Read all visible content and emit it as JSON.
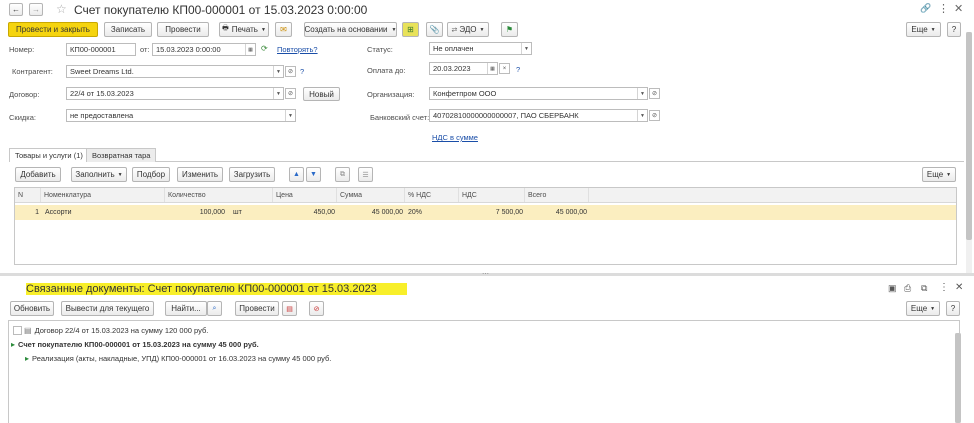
{
  "window": {
    "title": "Счет покупателю КП00-000001 от 15.03.2023 0:00:00"
  },
  "toolbar": {
    "post_close": "Провести и закрыть",
    "save": "Записать",
    "post": "Провести",
    "print": "Печать",
    "create_based": "Создать на основании",
    "edo": "ЭДО",
    "more": "Еще"
  },
  "form": {
    "number_label": "Номер:",
    "number_value": "КП00-000001",
    "from_label": "от:",
    "date_value": "15.03.2023  0:00:00",
    "repeat_link": "Повторять?",
    "status_label": "Статус:",
    "status_value": "Не оплачен",
    "counterparty_label": "Контрагент:",
    "counterparty_value": "Sweet Dreams Ltd.",
    "pay_by_label": "Оплата до:",
    "pay_by_value": "20.03.2023",
    "contract_label": "Договор:",
    "contract_value": "22/4 от 15.03.2023",
    "new_button": "Новый",
    "org_label": "Организация:",
    "org_value": "Конфетпром ООО",
    "discount_label": "Скидка:",
    "discount_value": "не предоставлена",
    "bank_label": "Банковский счет:",
    "bank_value": "40702810000000000007, ПАО СБЕРБАНК",
    "vat_link": "НДС в сумме",
    "question": "?"
  },
  "tabs": [
    {
      "label": "Товары и услуги (1)"
    },
    {
      "label": "Возвратная тара"
    }
  ],
  "table_toolbar": {
    "add": "Добавить",
    "fill": "Заполнить",
    "select": "Подбор",
    "change": "Изменить",
    "load": "Загрузить",
    "more": "Еще"
  },
  "table": {
    "headers": [
      "N",
      "Номенклатура",
      "Количество",
      "Цена",
      "Сумма",
      "% НДС",
      "НДС",
      "Всего"
    ],
    "rows": [
      {
        "n": "1",
        "item": "Ассорти",
        "qty": "100,000",
        "unit": "шт",
        "price": "450,00",
        "sum": "45 000,00",
        "vat_rate": "20%",
        "vat": "7 500,00",
        "total": "45 000,00"
      }
    ]
  },
  "related": {
    "title": "Связанные документы: Счет покупателю КП00-000001 от 15.03.2023",
    "refresh": "Обновить",
    "show_current": "Вывести для текущего",
    "find": "Найти...",
    "post": "Провести",
    "more": "Еще",
    "docs": [
      {
        "text": "Договор 22/4 от 15.03.2023 на сумму 120 000 руб."
      },
      {
        "text": "Счет покупателю КП00-000001 от 15.03.2023 на сумму 45 000 руб."
      },
      {
        "text": "Реализация (акты, накладные, УПД) КП00-000001 от 16.03.2023 на сумму 45 000 руб."
      }
    ]
  },
  "colors": {
    "accent_yellow": "#f5d40f",
    "selected_row": "#fbeec0",
    "link": "#1a4ea8",
    "title_highlight": "#f8ef2a"
  }
}
